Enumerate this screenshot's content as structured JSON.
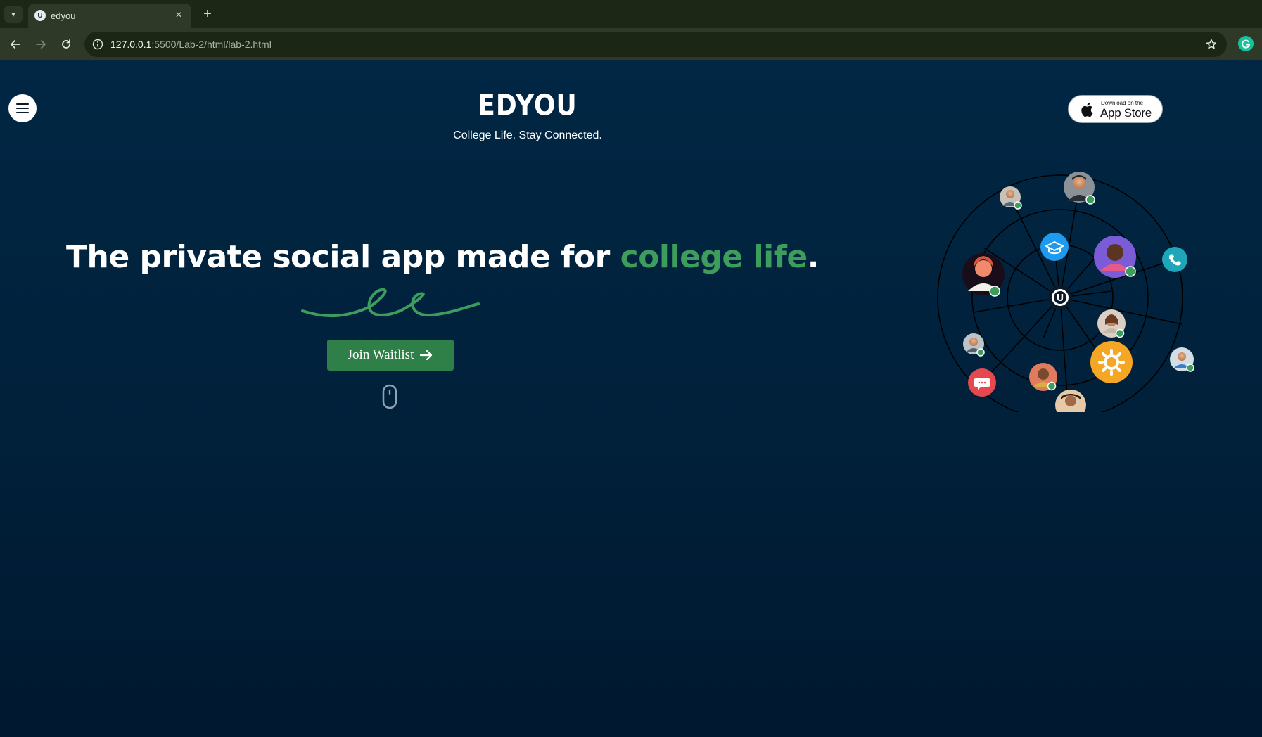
{
  "browser": {
    "tab_title": "edyou",
    "tab_favicon_letter": "U",
    "url_host": "127.0.0.1",
    "url_rest": ":5500/Lab-2/html/lab-2.html"
  },
  "brand": {
    "logo_text": "EDYOU",
    "tagline": "College Life. Stay Connected."
  },
  "app_store": {
    "small_text": "Download on the",
    "big_text": "App Store"
  },
  "hero": {
    "headline_part1": "The private social app made for ",
    "headline_highlight": "college life",
    "headline_end": "."
  },
  "cta": {
    "label": "Join Waitlist"
  },
  "network": {
    "center_letter": "U"
  },
  "colors": {
    "page_bg": "#012744",
    "accent_green": "#3d9d5c",
    "button_green": "#2f8048",
    "feature_blue": "#1d9bf0",
    "feature_orange": "#f5a623",
    "feature_red": "#e5484d",
    "feature_teal": "#1fa6b8"
  },
  "icons": [
    "tab-search-icon",
    "close-icon",
    "plus-icon",
    "back-icon",
    "forward-icon",
    "reload-icon",
    "site-info-icon",
    "bookmark-star-icon",
    "grammarly-icon",
    "hamburger-icon",
    "apple-icon",
    "arrow-right-icon",
    "mouse-scroll-icon",
    "graduation-cap-icon",
    "phone-icon",
    "gear-icon",
    "chat-bubble-icon"
  ]
}
